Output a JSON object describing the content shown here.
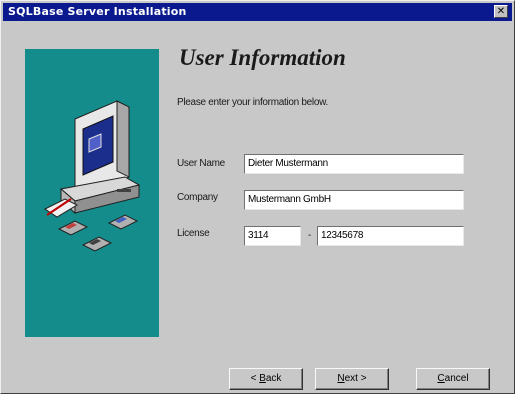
{
  "window": {
    "title": "SQLBase Server Installation",
    "close_glyph": "✕"
  },
  "page": {
    "heading": "User Information",
    "intro": "Please enter your information below."
  },
  "form": {
    "user_name": {
      "label": "User Name",
      "value": "Dieter Mustermann"
    },
    "company": {
      "label": "Company",
      "value": "Mustermann GmbH"
    },
    "license": {
      "label": "License",
      "part1": "3114",
      "separator": "-",
      "part2": "12345678"
    }
  },
  "buttons": {
    "back": {
      "underline": "B",
      "rest": "ack",
      "prefix": "< "
    },
    "next": {
      "underline": "N",
      "rest": "ext",
      "suffix": " >"
    },
    "cancel": {
      "underline": "C",
      "rest": "ancel"
    }
  },
  "icons": {
    "side_panel": "computer-with-disks-illustration"
  },
  "colors": {
    "titlebar": "#0a1a8e",
    "side_panel": "#148c8c",
    "dialog": "#c8c8c8"
  }
}
